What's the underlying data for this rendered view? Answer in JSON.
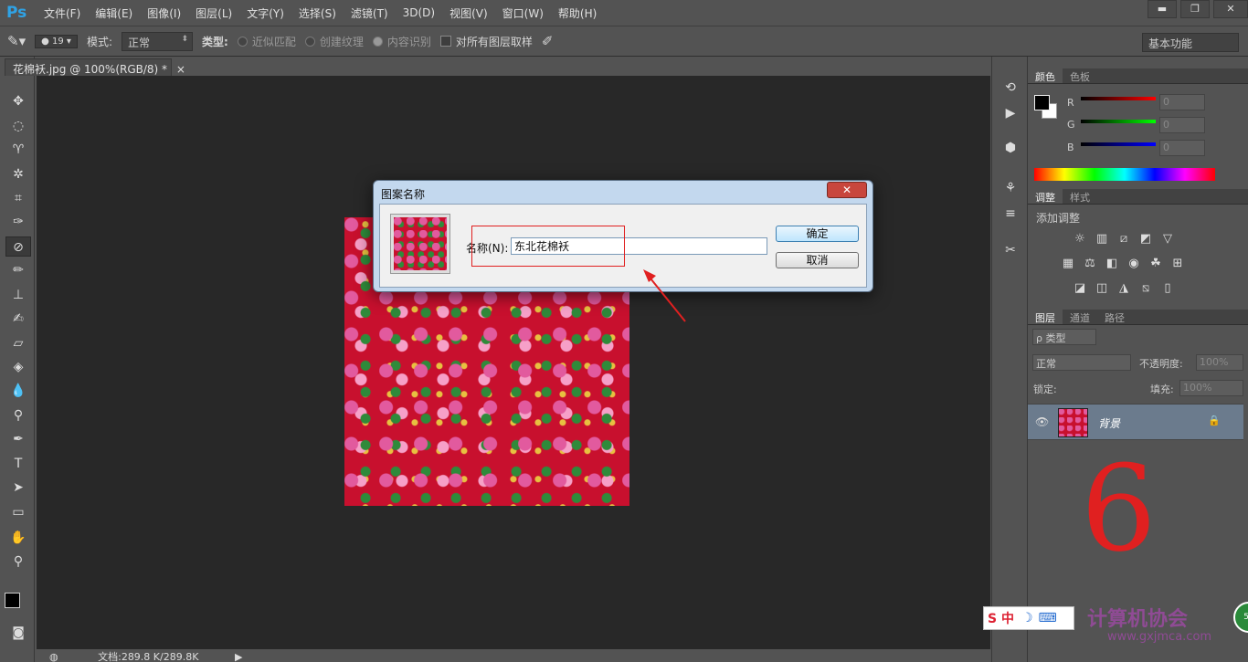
{
  "app": {
    "logo": "Ps"
  },
  "menu": [
    "文件(F)",
    "编辑(E)",
    "图像(I)",
    "图层(L)",
    "文字(Y)",
    "选择(S)",
    "滤镜(T)",
    "3D(D)",
    "视图(V)",
    "窗口(W)",
    "帮助(H)"
  ],
  "window_controls": {
    "minimize": "▬",
    "restore": "❐",
    "close": "✕"
  },
  "options": {
    "brush_size": "19",
    "mode_label": "模式:",
    "mode_value": "正常",
    "type_label": "类型:",
    "type_options": [
      "近似匹配",
      "创建纹理",
      "内容识别"
    ],
    "sample_all": "对所有图层取样",
    "workspace": "基本功能"
  },
  "document": {
    "tab_title": "花棉袄.jpg @ 100%(RGB/8) *",
    "close": "×",
    "status": "文档:289.8 K/289.8K"
  },
  "color_panel": {
    "tabs": [
      "颜色",
      "色板"
    ],
    "channels": [
      {
        "name": "R",
        "value": "0",
        "color": "#e01010"
      },
      {
        "name": "G",
        "value": "0",
        "color": "#10c010"
      },
      {
        "name": "B",
        "value": "0",
        "color": "#1020e0"
      }
    ]
  },
  "adjust_panel": {
    "tabs": [
      "调整",
      "样式"
    ],
    "title": "添加调整"
  },
  "layers_panel": {
    "tabs": [
      "图层",
      "通道",
      "路径"
    ],
    "filter": "ρ 类型",
    "blend": "正常",
    "opacity_label": "不透明度:",
    "opacity": "100%",
    "lock_label": "锁定:",
    "fill_label": "填充:",
    "fill": "100%",
    "layer_name": "背景"
  },
  "dialog": {
    "title": "图案名称",
    "close": "✕",
    "name_label": "名称(N):",
    "name_value": "东北花棉袄",
    "ok": "确定",
    "cancel": "取消"
  },
  "annotation": {
    "digit": "6"
  },
  "overlay": {
    "ime": "S 中",
    "watermark": "计算机协会",
    "watermark_url": "www.gxjmca.com",
    "badge": "59"
  },
  "colors": {
    "canvas": "#282828",
    "panel": "#535353",
    "pattern_red": "#c8102e",
    "annotation_red": "#e02020"
  }
}
